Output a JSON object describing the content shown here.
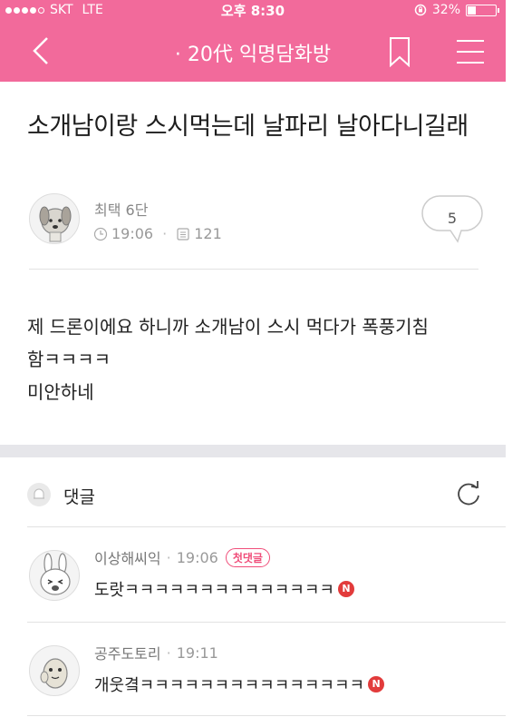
{
  "status_bar": {
    "carrier": "SKT",
    "network": "LTE",
    "time": "오후 8:30",
    "battery": "32%",
    "battery_level": 0.32
  },
  "navbar": {
    "title": "· 20代 익명담화방",
    "back_icon": "chevron-left-icon",
    "bookmark_icon": "bookmark-icon",
    "menu_icon": "hamburger-menu-icon"
  },
  "post": {
    "title": "소개남이랑 스시먹는데 날파리 날아다니길래",
    "author": "최택 6단",
    "time": "19:06",
    "views": "121",
    "comment_count": "5",
    "body_lines": [
      "제 드론이에요 하니까 소개남이 스시 먹다가 폭풍기침",
      "함ㅋㅋㅋㅋ",
      "미안하네"
    ]
  },
  "comments_section": {
    "label": "댓글",
    "items": [
      {
        "author": "이상해씨익",
        "time": "19:06",
        "badge": "첫댓글",
        "text": "도랏ㅋㅋㅋㅋㅋㅋㅋㅋㅋㅋㅋㅋㅋㅋ",
        "new_marker": "N"
      },
      {
        "author": "공주도토리",
        "time": "19:11",
        "text": "개웃곀ㅋㅋㅋㅋㅋㅋㅋㅋㅋㅋㅋㅋㅋㅋㅋ",
        "new_marker": "N"
      }
    ]
  },
  "colors": {
    "header_pink": "#f26a9b",
    "badge_pink": "#f04e7a",
    "new_red": "#e23b3b"
  }
}
